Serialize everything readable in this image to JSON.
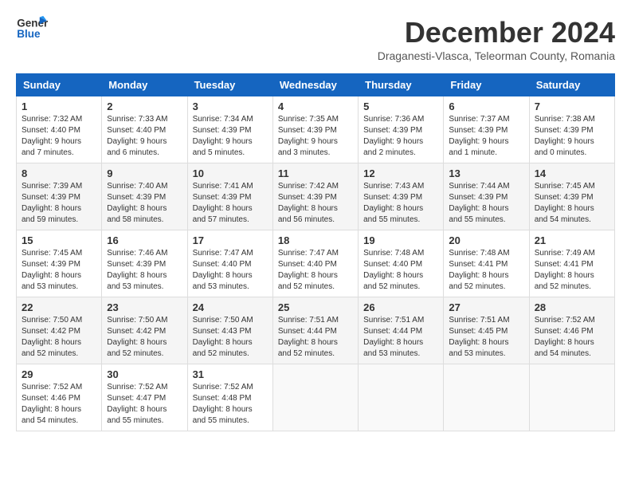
{
  "header": {
    "logo_general": "General",
    "logo_blue": "Blue",
    "month_title": "December 2024",
    "subtitle": "Draganesti-Vlasca, Teleorman County, Romania"
  },
  "calendar": {
    "days_of_week": [
      "Sunday",
      "Monday",
      "Tuesday",
      "Wednesday",
      "Thursday",
      "Friday",
      "Saturday"
    ],
    "weeks": [
      [
        {
          "day": "1",
          "sunrise": "7:32 AM",
          "sunset": "4:40 PM",
          "daylight": "9 hours and 7 minutes."
        },
        {
          "day": "2",
          "sunrise": "7:33 AM",
          "sunset": "4:40 PM",
          "daylight": "9 hours and 6 minutes."
        },
        {
          "day": "3",
          "sunrise": "7:34 AM",
          "sunset": "4:39 PM",
          "daylight": "9 hours and 5 minutes."
        },
        {
          "day": "4",
          "sunrise": "7:35 AM",
          "sunset": "4:39 PM",
          "daylight": "9 hours and 3 minutes."
        },
        {
          "day": "5",
          "sunrise": "7:36 AM",
          "sunset": "4:39 PM",
          "daylight": "9 hours and 2 minutes."
        },
        {
          "day": "6",
          "sunrise": "7:37 AM",
          "sunset": "4:39 PM",
          "daylight": "9 hours and 1 minute."
        },
        {
          "day": "7",
          "sunrise": "7:38 AM",
          "sunset": "4:39 PM",
          "daylight": "9 hours and 0 minutes."
        }
      ],
      [
        {
          "day": "8",
          "sunrise": "7:39 AM",
          "sunset": "4:39 PM",
          "daylight": "8 hours and 59 minutes."
        },
        {
          "day": "9",
          "sunrise": "7:40 AM",
          "sunset": "4:39 PM",
          "daylight": "8 hours and 58 minutes."
        },
        {
          "day": "10",
          "sunrise": "7:41 AM",
          "sunset": "4:39 PM",
          "daylight": "8 hours and 57 minutes."
        },
        {
          "day": "11",
          "sunrise": "7:42 AM",
          "sunset": "4:39 PM",
          "daylight": "8 hours and 56 minutes."
        },
        {
          "day": "12",
          "sunrise": "7:43 AM",
          "sunset": "4:39 PM",
          "daylight": "8 hours and 55 minutes."
        },
        {
          "day": "13",
          "sunrise": "7:44 AM",
          "sunset": "4:39 PM",
          "daylight": "8 hours and 55 minutes."
        },
        {
          "day": "14",
          "sunrise": "7:45 AM",
          "sunset": "4:39 PM",
          "daylight": "8 hours and 54 minutes."
        }
      ],
      [
        {
          "day": "15",
          "sunrise": "7:45 AM",
          "sunset": "4:39 PM",
          "daylight": "8 hours and 53 minutes."
        },
        {
          "day": "16",
          "sunrise": "7:46 AM",
          "sunset": "4:39 PM",
          "daylight": "8 hours and 53 minutes."
        },
        {
          "day": "17",
          "sunrise": "7:47 AM",
          "sunset": "4:40 PM",
          "daylight": "8 hours and 53 minutes."
        },
        {
          "day": "18",
          "sunrise": "7:47 AM",
          "sunset": "4:40 PM",
          "daylight": "8 hours and 52 minutes."
        },
        {
          "day": "19",
          "sunrise": "7:48 AM",
          "sunset": "4:40 PM",
          "daylight": "8 hours and 52 minutes."
        },
        {
          "day": "20",
          "sunrise": "7:48 AM",
          "sunset": "4:41 PM",
          "daylight": "8 hours and 52 minutes."
        },
        {
          "day": "21",
          "sunrise": "7:49 AM",
          "sunset": "4:41 PM",
          "daylight": "8 hours and 52 minutes."
        }
      ],
      [
        {
          "day": "22",
          "sunrise": "7:50 AM",
          "sunset": "4:42 PM",
          "daylight": "8 hours and 52 minutes."
        },
        {
          "day": "23",
          "sunrise": "7:50 AM",
          "sunset": "4:42 PM",
          "daylight": "8 hours and 52 minutes."
        },
        {
          "day": "24",
          "sunrise": "7:50 AM",
          "sunset": "4:43 PM",
          "daylight": "8 hours and 52 minutes."
        },
        {
          "day": "25",
          "sunrise": "7:51 AM",
          "sunset": "4:44 PM",
          "daylight": "8 hours and 52 minutes."
        },
        {
          "day": "26",
          "sunrise": "7:51 AM",
          "sunset": "4:44 PM",
          "daylight": "8 hours and 53 minutes."
        },
        {
          "day": "27",
          "sunrise": "7:51 AM",
          "sunset": "4:45 PM",
          "daylight": "8 hours and 53 minutes."
        },
        {
          "day": "28",
          "sunrise": "7:52 AM",
          "sunset": "4:46 PM",
          "daylight": "8 hours and 54 minutes."
        }
      ],
      [
        {
          "day": "29",
          "sunrise": "7:52 AM",
          "sunset": "4:46 PM",
          "daylight": "8 hours and 54 minutes."
        },
        {
          "day": "30",
          "sunrise": "7:52 AM",
          "sunset": "4:47 PM",
          "daylight": "8 hours and 55 minutes."
        },
        {
          "day": "31",
          "sunrise": "7:52 AM",
          "sunset": "4:48 PM",
          "daylight": "8 hours and 55 minutes."
        },
        null,
        null,
        null,
        null
      ]
    ]
  }
}
